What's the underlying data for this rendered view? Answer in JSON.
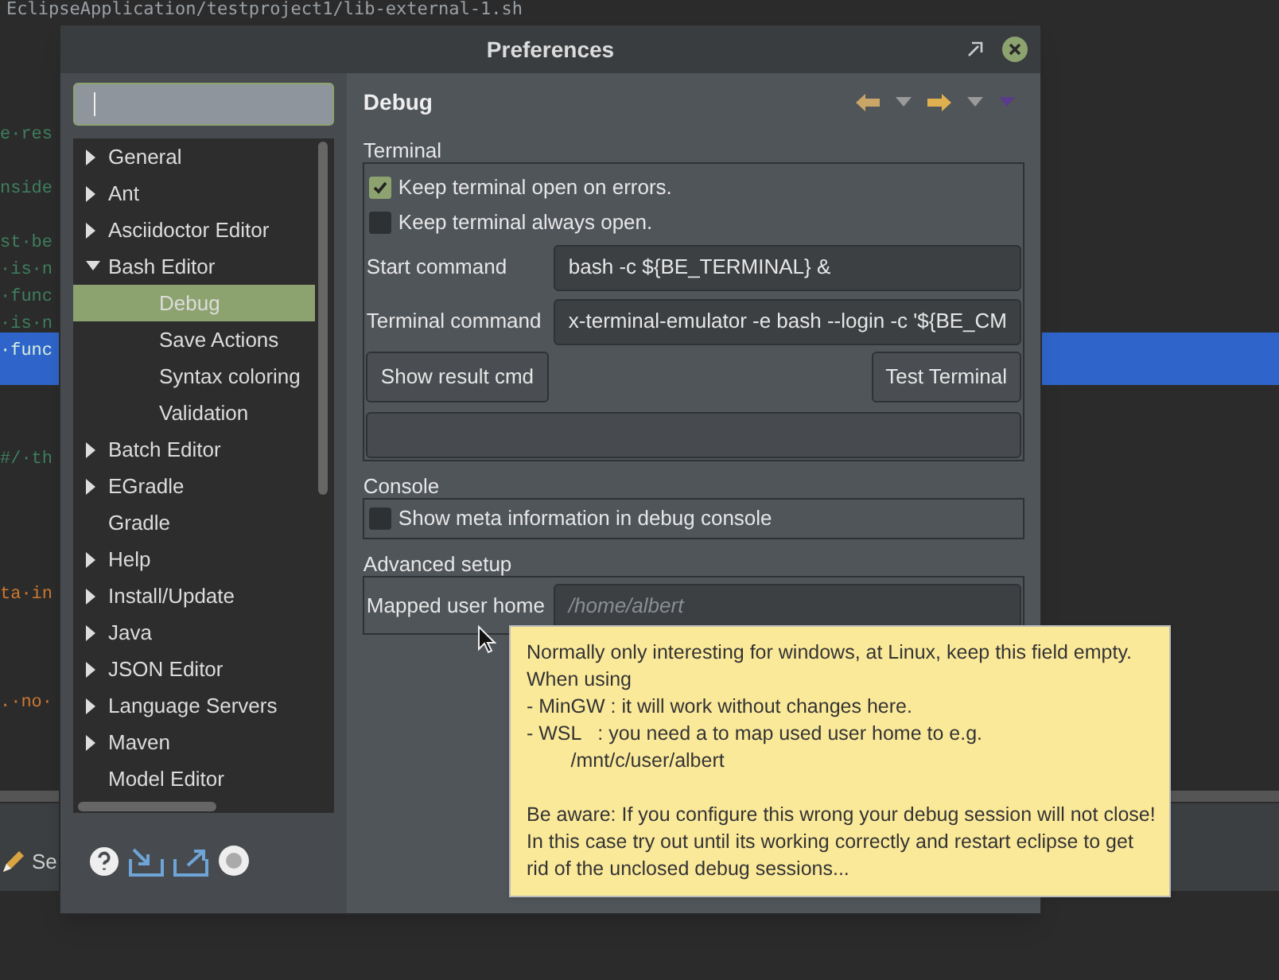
{
  "editor": {
    "path": "EclipseApplication/testproject1/lib-external-1.sh",
    "lines": [
      {
        "text": "e·res",
        "kind": "comment",
        "selected": false
      },
      {
        "text": "nside",
        "kind": "comment",
        "selected": false
      },
      {
        "text": "st·be",
        "kind": "comment",
        "selected": false
      },
      {
        "text": "·is·n",
        "kind": "comment",
        "selected": false
      },
      {
        "text": "·func",
        "kind": "comment",
        "selected": false
      },
      {
        "text": "·is·n",
        "kind": "comment",
        "selected": false
      },
      {
        "text": "·func",
        "kind": "comment",
        "selected": true
      },
      {
        "text": "#/·th",
        "kind": "comment",
        "selected": false
      },
      {
        "text": "ta·in",
        "kind": "string",
        "selected": false
      },
      {
        "text": ".·no·",
        "kind": "string",
        "selected": false
      }
    ],
    "bottom_tab": "Se"
  },
  "window": {
    "title": "Preferences"
  },
  "tree": [
    {
      "label": "General",
      "expanded": false,
      "selected": false
    },
    {
      "label": "Ant",
      "expanded": false,
      "selected": false
    },
    {
      "label": "Asciidoctor Editor",
      "expanded": false,
      "selected": false
    },
    {
      "label": "Bash Editor",
      "expanded": true,
      "selected": false,
      "children": [
        {
          "label": "Debug",
          "selected": true
        },
        {
          "label": "Save Actions",
          "selected": false
        },
        {
          "label": "Syntax coloring",
          "selected": false
        },
        {
          "label": "Validation",
          "selected": false
        }
      ]
    },
    {
      "label": "Batch Editor",
      "expanded": false,
      "selected": false
    },
    {
      "label": "EGradle",
      "expanded": false,
      "selected": false
    },
    {
      "label": "Gradle",
      "selected": false
    },
    {
      "label": "Help",
      "expanded": false,
      "selected": false
    },
    {
      "label": "Install/Update",
      "expanded": false,
      "selected": false
    },
    {
      "label": "Java",
      "expanded": false,
      "selected": false
    },
    {
      "label": "JSON Editor",
      "expanded": false,
      "selected": false
    },
    {
      "label": "Language Servers",
      "expanded": false,
      "selected": false
    },
    {
      "label": "Maven",
      "expanded": false,
      "selected": false
    },
    {
      "label": "Model Editor",
      "selected": false
    }
  ],
  "page": {
    "title": "Debug",
    "terminal": {
      "label": "Terminal",
      "checkboxes": [
        {
          "label": "Keep terminal open on errors.",
          "checked": true
        },
        {
          "label": "Keep terminal always open.",
          "checked": false
        }
      ],
      "fields": [
        {
          "label": "Start command",
          "value": "bash -c ${BE_TERMINAL} &"
        },
        {
          "label": "Terminal command",
          "value": "x-terminal-emulator -e bash --login -c '${BE_CM"
        }
      ],
      "buttons": [
        "Show result cmd",
        "Test Terminal"
      ]
    },
    "console": {
      "label": "Console",
      "checkboxes": [
        {
          "label": "Show meta information in debug console",
          "checked": false
        }
      ]
    },
    "advanced": {
      "label": "Advanced setup",
      "fields": [
        {
          "label": "Mapped user home",
          "placeholder": "/home/albert"
        }
      ]
    }
  },
  "tooltip": {
    "lines": [
      "Normally only interesting for windows, at Linux, keep this field empty.",
      "When using",
      "- MinGW : it will work without changes here.",
      "- WSL   : you need a to map used user home to e.g.",
      "        /mnt/c/user/albert",
      "Be aware: If you configure this wrong your debug session will not close!",
      "In this case try out until its working correctly and restart eclipse to get",
      "rid of the unclosed debug sessions..."
    ]
  }
}
